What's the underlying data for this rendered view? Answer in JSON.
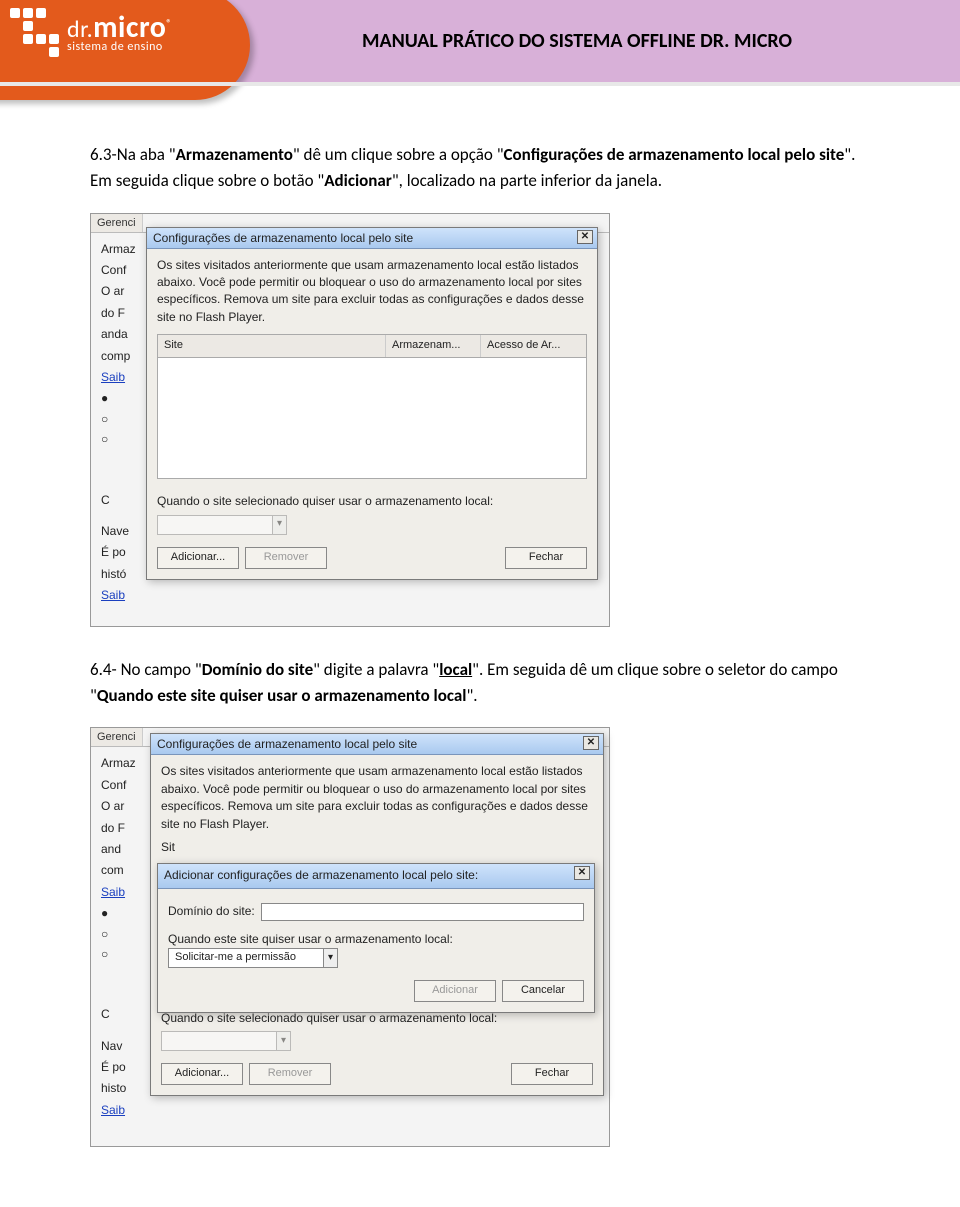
{
  "header": {
    "brand_dr": "dr.",
    "brand_main": "micro",
    "brand_reg": "®",
    "brand_sub": "sistema de ensino",
    "manual_title": "MANUAL PRÁTICO DO SISTEMA OFFLINE DR. MICRO"
  },
  "body": {
    "p1a": "6.3-Na aba \"",
    "p1b": "Armazenamento",
    "p1c": "\" dê um clique sobre a opção \"",
    "p1d": "Configurações de armazenamento local pelo site",
    "p1e": "\". Em seguida clique sobre o botão \"",
    "p1f": "Adicionar",
    "p1g": "\", localizado na parte inferior da janela.",
    "p2a": "6.4- No campo \"",
    "p2b": "Domínio do site",
    "p2c": "\" digite a palavra \"",
    "p2d": "local",
    "p2e": "\". Em seguida dê um clique sobre o seletor do campo \"",
    "p2f": "Quando este site quiser usar o armazenamento local",
    "p2g": "\"."
  },
  "shot1": {
    "bg": {
      "tab": "Gerenci",
      "line1": "Armaz",
      "line2": "Conf",
      "para1": "O ar",
      "para2": "do F",
      "para3": "anda",
      "para4": "comp",
      "link1": "Saib",
      "r1": "",
      "r2": "",
      "r3": "",
      "section": "C",
      "nav": "Nave",
      "epo": "É po",
      "hist": "histó",
      "link2": "Saib"
    },
    "pop": {
      "title": "Configurações de armazenamento local pelo site",
      "desc": "Os sites visitados anteriormente que usam armazenamento local estão listados abaixo. Você pode permitir ou bloquear o uso do armazenamento local por sites específicos. Remova um site para excluir todas as configurações e dados desse site no Flash Player.",
      "col_site": "Site",
      "col_arm": "Armazenam...",
      "col_acc": "Acesso de Ar...",
      "prompt": "Quando o site selecionado quiser usar o armazenamento local:",
      "btn_add": "Adicionar...",
      "btn_rem": "Remover",
      "btn_close": "Fechar"
    }
  },
  "shot2": {
    "bg": {
      "tab": "Gerenci",
      "line1": "Armaz",
      "line2": "Conf",
      "para1": "O ar",
      "para2": "do F",
      "para3": "and",
      "para4": "com",
      "link1": "Saib",
      "section": "C",
      "nav": "Nav",
      "epo": "É po",
      "hist": "histo",
      "link2": "Saib"
    },
    "outer": {
      "title": "Configurações de armazenamento local pelo site",
      "desc": "Os sites visitados anteriormente que usam armazenamento local estão listados abaixo. Você pode permitir ou bloquear o uso do armazenamento local por sites específicos. Remova um site para excluir todas as configurações e dados desse site no Flash Player.",
      "sit": "Sit",
      "prompt": "Quando o site selecionado quiser usar o armazenamento local:",
      "btn_add": "Adicionar...",
      "btn_rem": "Remover",
      "btn_close": "Fechar"
    },
    "inner": {
      "title": "Adicionar configurações de armazenamento local pelo site:",
      "field_label": "Domínio do site:",
      "prompt": "Quando este site quiser usar o armazenamento local:",
      "combo_value": "Solicitar-me a permissão",
      "btn_add": "Adicionar",
      "btn_cancel": "Cancelar"
    }
  }
}
